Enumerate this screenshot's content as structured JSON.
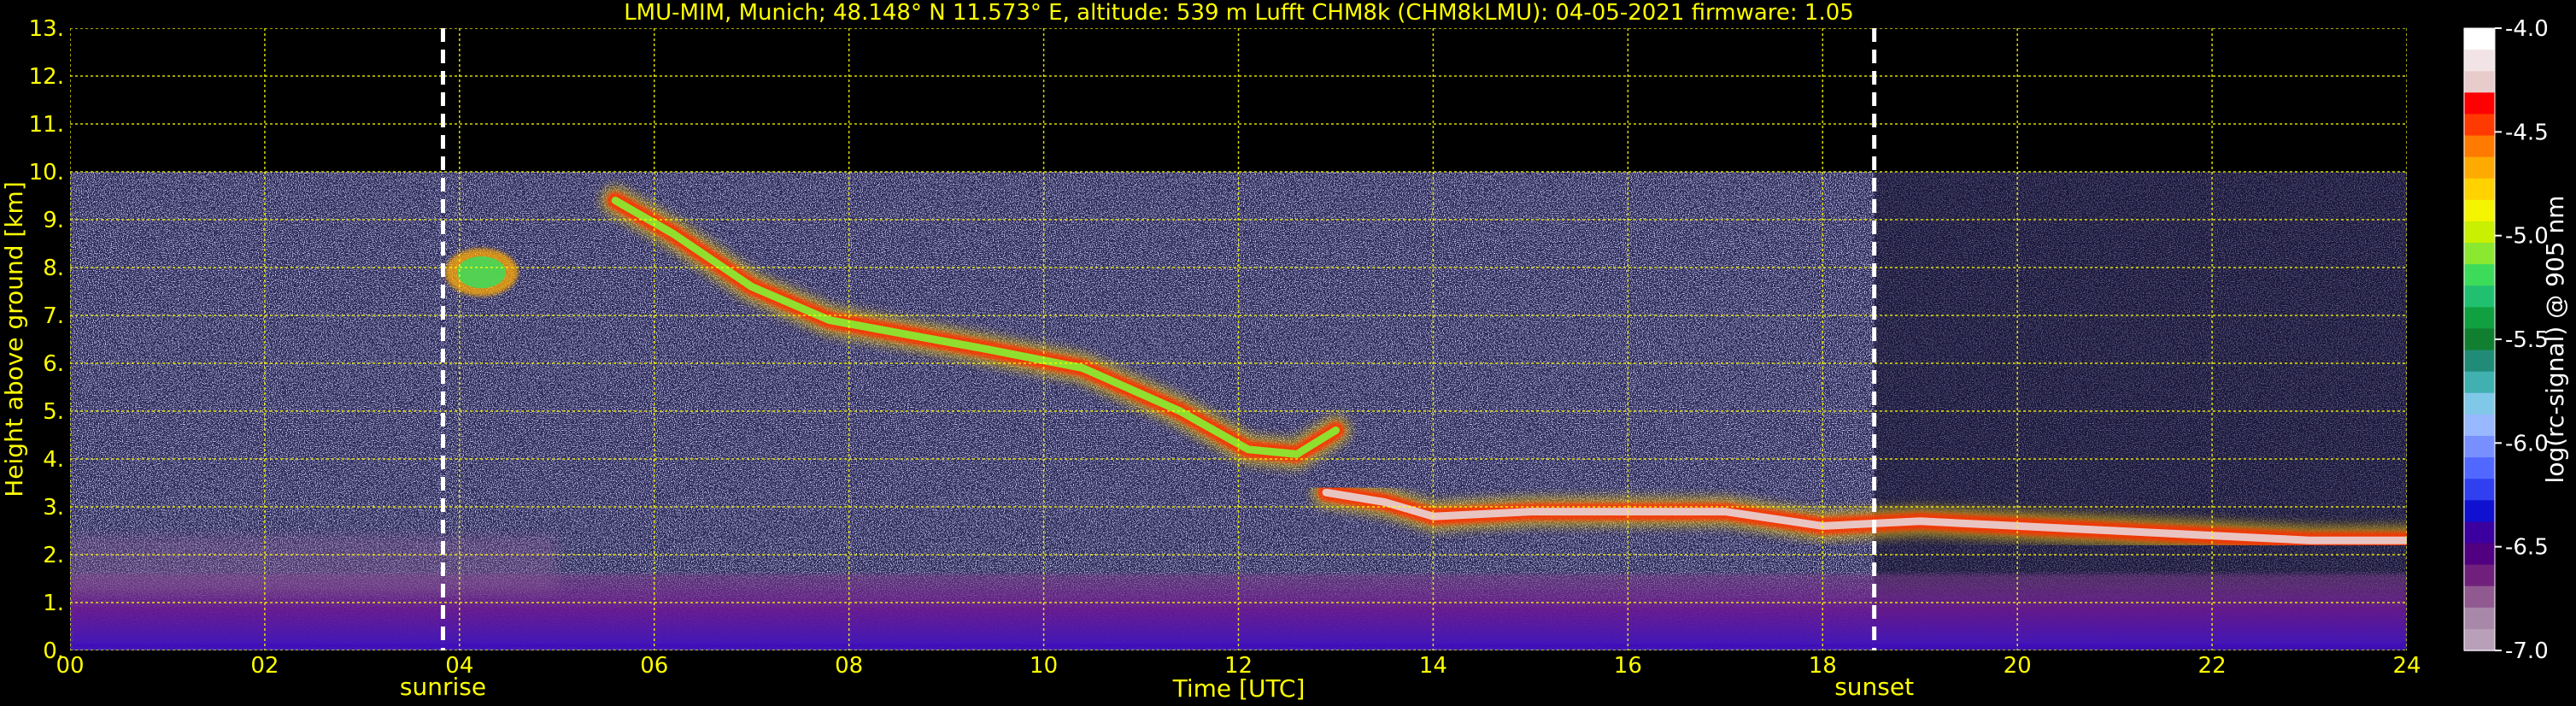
{
  "chart_data": {
    "type": "heatmap",
    "title": "LMU-MIM, Munich; 48.148° N 11.573° E, altitude: 539 m    Lufft CHM8k (CHM8kLMU): 04-05-2021    firmware: 1.05",
    "xlabel": "Time [UTC]",
    "ylabel": "Height above ground [km]",
    "xlim": [
      0,
      24
    ],
    "ylim": [
      0,
      13
    ],
    "x_ticks": [
      0,
      2,
      4,
      6,
      8,
      10,
      12,
      14,
      16,
      18,
      20,
      22,
      24
    ],
    "x_tick_labels": [
      "00",
      "02",
      "04",
      "06",
      "08",
      "10",
      "12",
      "14",
      "16",
      "18",
      "20",
      "22",
      "24"
    ],
    "y_ticks": [
      0,
      1,
      2,
      3,
      4,
      5,
      6,
      7,
      8,
      9,
      10,
      11,
      12,
      13
    ],
    "y_tick_labels": [
      "0.",
      "1.",
      "2.",
      "3.",
      "4.",
      "5.",
      "6.",
      "7.",
      "8.",
      "9.",
      "10.",
      "11.",
      "12.",
      "13."
    ],
    "grid": true,
    "data_top_km": 10,
    "events": [
      {
        "name": "sunrise",
        "time": 3.83
      },
      {
        "name": "sunset",
        "time": 18.53
      }
    ],
    "colorbar": {
      "label": "log(rc-signal) @ 905 nm",
      "range": [
        -7.0,
        -4.0
      ],
      "ticks": [
        -4.0,
        -4.5,
        -5.0,
        -5.5,
        -6.0,
        -6.5,
        -7.0
      ],
      "tick_labels": [
        "-4.0",
        "-4.5",
        "-5.0",
        "-5.5",
        "-6.0",
        "-6.5",
        "-7.0"
      ],
      "colors_top_to_bottom": [
        "#ffffff",
        "#f2e4e6",
        "#e8cccc",
        "#ff0000",
        "#ff3a00",
        "#ff7a00",
        "#ffaa00",
        "#ffd200",
        "#f5f500",
        "#c8f000",
        "#8ae830",
        "#3cdc5a",
        "#20c070",
        "#10a040",
        "#108030",
        "#208c78",
        "#40b0b0",
        "#80c8e8",
        "#98b8ff",
        "#7890ff",
        "#5068ff",
        "#3040f0",
        "#1010d0",
        "#3c00a0",
        "#500080",
        "#70207c",
        "#905a90",
        "#a888a8",
        "#b8a0b8"
      ]
    },
    "features": [
      {
        "name": "boundary layer",
        "start": 0,
        "end": 24,
        "base_km": 0,
        "top_km": 1.6,
        "log_signal": -6.5
      },
      {
        "name": "morning residual layer",
        "start": 0,
        "end": 5,
        "base_km": 1.2,
        "top_km": 2.4,
        "log_signal": -6.7
      },
      {
        "name": "cirrus sunrise",
        "start": 3.85,
        "end": 4.6,
        "base_km": 7.4,
        "top_km": 8.4,
        "log_signal": -5.2
      },
      {
        "name": "cirrus descending",
        "points": [
          [
            5.6,
            9.4
          ],
          [
            6.2,
            8.7
          ],
          [
            7.0,
            7.6
          ],
          [
            7.8,
            6.9
          ],
          [
            8.6,
            6.6
          ],
          [
            9.4,
            6.3
          ],
          [
            10.4,
            5.9
          ],
          [
            11.4,
            5.0
          ],
          [
            12.1,
            4.2
          ],
          [
            12.6,
            4.1
          ],
          [
            13.0,
            4.6
          ]
        ],
        "log_signal": -5.1
      },
      {
        "name": "cloud layer",
        "points": [
          [
            12.9,
            3.3
          ],
          [
            13.5,
            3.1
          ],
          [
            14.0,
            2.8
          ],
          [
            15.0,
            2.9
          ],
          [
            16.0,
            2.9
          ],
          [
            17.0,
            2.9
          ],
          [
            18.0,
            2.6
          ],
          [
            19.0,
            2.7
          ],
          [
            20.0,
            2.6
          ],
          [
            21.0,
            2.5
          ],
          [
            22.0,
            2.4
          ],
          [
            23.0,
            2.3
          ],
          [
            24.0,
            2.3
          ]
        ],
        "log_signal": -4.2
      }
    ]
  }
}
